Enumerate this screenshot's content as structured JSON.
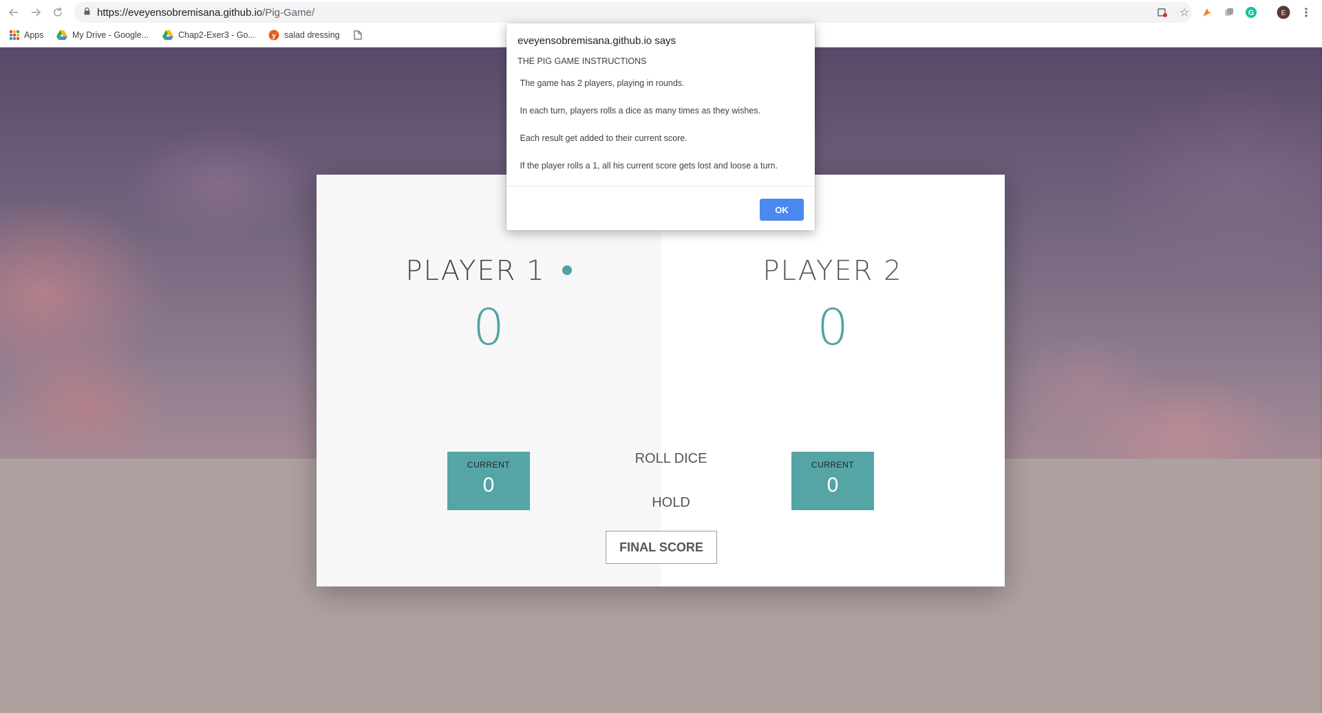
{
  "browser": {
    "url_host": "https://eveyensobremisana.github.io",
    "url_path": "/Pig-Game/",
    "avatar_letter": "E",
    "bookmarks": [
      {
        "label": "Apps",
        "icon": "apps-grid-icon"
      },
      {
        "label": "My Drive - Google...",
        "icon": "drive-icon"
      },
      {
        "label": "Chap2-Exer3 - Go...",
        "icon": "drive-icon"
      },
      {
        "label": "salad dressing",
        "icon": "yummly-icon"
      },
      {
        "label": "",
        "icon": "document-icon"
      }
    ]
  },
  "game": {
    "players": [
      {
        "name": "Player 1",
        "score": "0",
        "current_label": "Current",
        "current_score": "0",
        "active": true
      },
      {
        "name": "Player 2",
        "score": "0",
        "current_label": "Current",
        "current_score": "0",
        "active": false
      }
    ],
    "roll_label": "Roll dice",
    "hold_label": "Hold",
    "final_score_label": "FINAL SCORE"
  },
  "dialog": {
    "title": "eveyensobremisana.github.io says",
    "heading": "THE PIG GAME INSTRUCTIONS",
    "lines": [
      " The game has 2 players, playing in rounds.",
      " In each turn, players rolls a dice as many times as they wishes.",
      " Each result get added to their current score.",
      " If the player rolls a 1, all his current score gets lost and loose a turn."
    ],
    "ok_label": "OK"
  },
  "colors": {
    "accent": "#4fa3a5",
    "current_box": "#55a4a6",
    "ok_button": "#4a89f0"
  }
}
